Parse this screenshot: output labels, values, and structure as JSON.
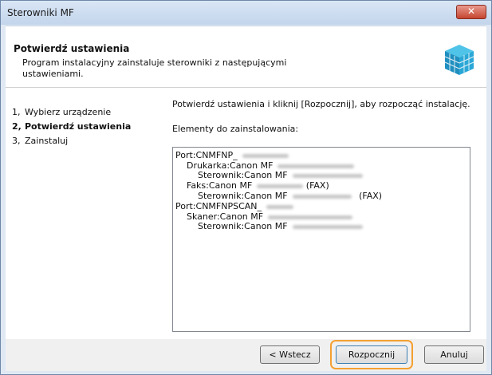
{
  "window": {
    "title": "Sterowniki MF",
    "close_label": "✕"
  },
  "header": {
    "title": "Potwierdź ustawienia",
    "description": "Program instalacyjny zainstaluje sterowniki z następującymi ustawieniami.",
    "icon": "installer-box-icon"
  },
  "steps": [
    {
      "num": "1,",
      "label": "Wybierz urządzenie"
    },
    {
      "num": "2,",
      "label": "Potwierdź ustawienia"
    },
    {
      "num": "3,",
      "label": "Zainstaluj"
    }
  ],
  "main": {
    "instruction": "Potwierdź ustawienia i kliknij [Rozpocznij], aby rozpocząć instalację.",
    "items_label": "Elementy do zainstalowania:",
    "items": [
      {
        "text": "Port:CNMFNP_"
      },
      {
        "text": "Drukarka:Canon MF"
      },
      {
        "text": "Sterownik:Canon MF"
      },
      {
        "text": "Faks:Canon MF",
        "suffix": "(FAX)"
      },
      {
        "text": "Sterownik:Canon MF",
        "suffix": "(FAX)"
      },
      {
        "text": "Port:CNMFNPSCAN_"
      },
      {
        "text": "Skaner:Canon MF"
      },
      {
        "text": "Sterownik:Canon MF"
      }
    ]
  },
  "buttons": {
    "back": "< Wstecz",
    "start": "Rozpocznij",
    "cancel": "Anuluj"
  },
  "colors": {
    "highlight": "#f5a030",
    "title_bar": "#c3d5ec",
    "close": "#c5452f"
  }
}
